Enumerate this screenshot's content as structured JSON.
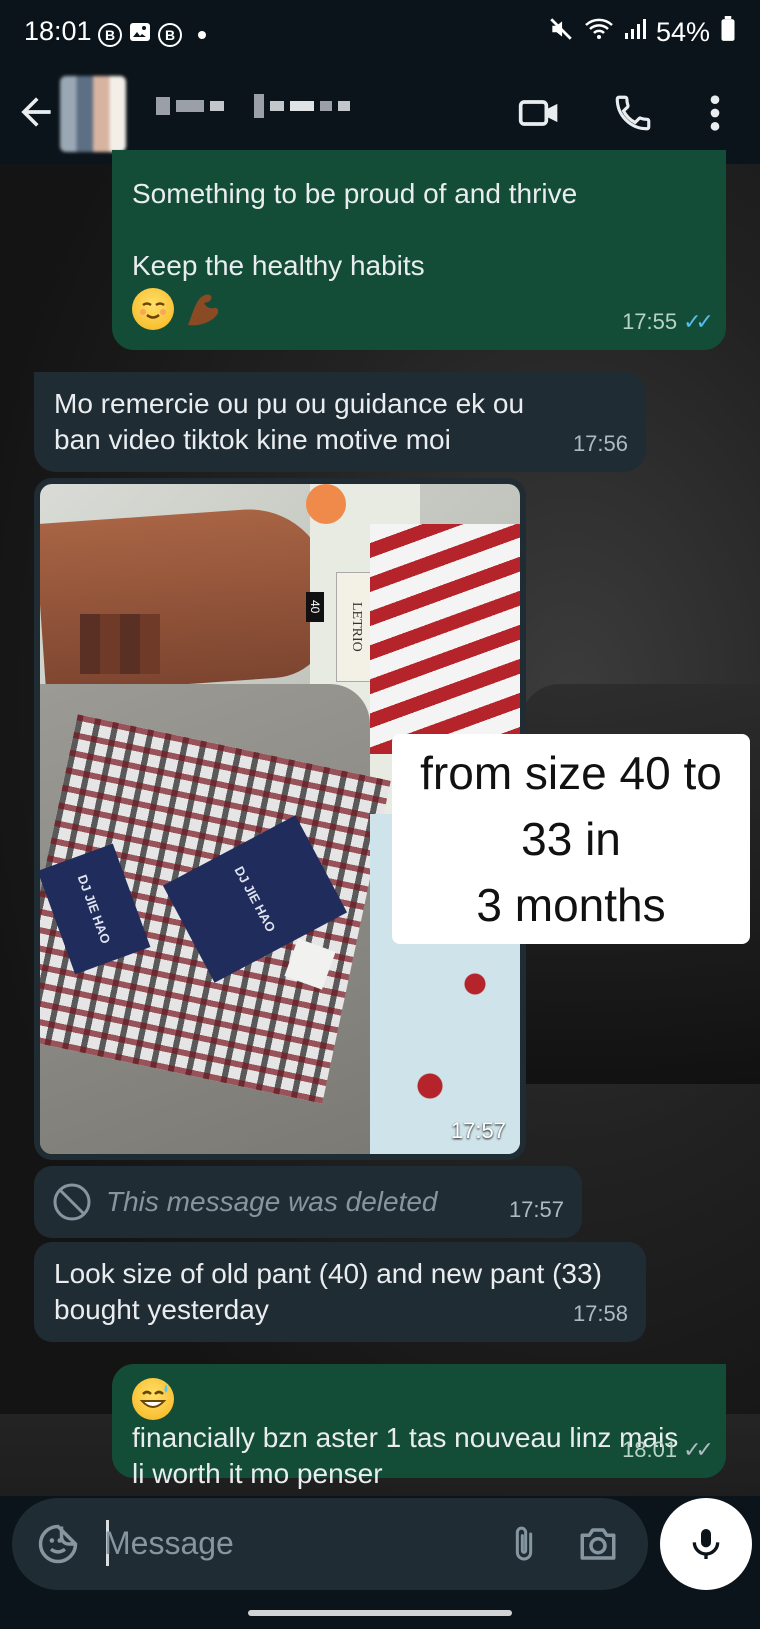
{
  "status_bar": {
    "time": "18:01",
    "left_badges": [
      "B",
      "B"
    ],
    "battery": "54%"
  },
  "header": {
    "back_icon": "arrow-left-icon",
    "video_icon": "video-call-icon",
    "call_icon": "phone-icon",
    "menu_icon": "more-vert-icon"
  },
  "messages": [
    {
      "direction": "out",
      "lines": [
        "Something to be proud of and thrive",
        "",
        "Keep the healthy habits"
      ],
      "emojis": [
        "relieved-face-emoji",
        "flexed-biceps-emoji"
      ],
      "time": "17:55",
      "status": "read"
    },
    {
      "direction": "in",
      "text": "Mo remercie ou pu ou guidance ek ou ban video tiktok kine motive moi",
      "time": "17:56"
    },
    {
      "direction": "in",
      "type": "image",
      "overlay_text": [
        "from size 40 to",
        "33 in",
        "3 months"
      ],
      "image_labels": [
        "LETRIO",
        "40",
        "DJ JIE HAO",
        "DJ JIE HAO"
      ],
      "time": "17:57"
    },
    {
      "direction": "in",
      "type": "deleted",
      "text": "This message was deleted",
      "time": "17:57"
    },
    {
      "direction": "in",
      "text": "Look size of old pant (40) and new pant (33) bought yesterday",
      "time": "17:58"
    },
    {
      "direction": "out",
      "text": "financially bzn aster 1 tas nouveau linz mais li worth it mo penser",
      "emojis": [
        "grinning-sweat-emoji"
      ],
      "time": "18:01",
      "status": "delivered"
    }
  ],
  "composer": {
    "placeholder": "Message"
  },
  "colors": {
    "outgoing_bubble": "#144d37",
    "incoming_bubble": "#202c33",
    "read_tick": "#53bdeb"
  }
}
